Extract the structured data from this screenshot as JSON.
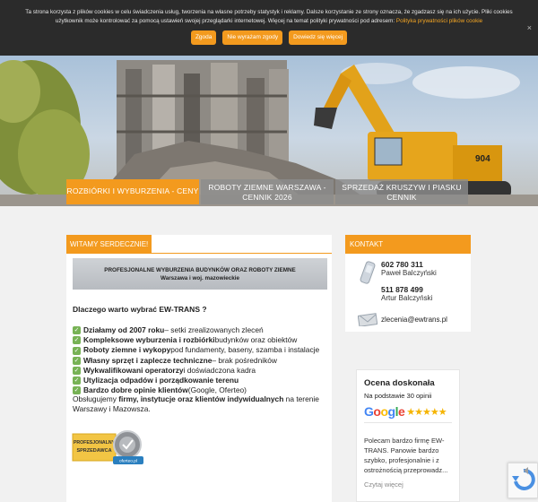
{
  "cookie": {
    "text": "Ta strona korzysta z plików cookies w celu świadczenia usług, tworzenia na własne potrzeby statystyk i reklamy. Dalsze korzystanie ze strony oznacza, że zgadzasz się na ich użycie. Pliki cookies użytkownik może kontrolować za pomocą ustawień swojej przeglądarki internetowej. Więcej na temat polityki prywatności pod adresem:",
    "link": "Polityka prywatności plików cookie",
    "btn_agree": "Zgoda",
    "btn_disagree": "Nie wyrażam zgody",
    "btn_more": "Dowiedz się więcej",
    "close": "×"
  },
  "nav": [
    {
      "label": "Rozbiórki i wyburzenia - ceny"
    },
    {
      "label": "ROBOTY ZIEMNE WARSZAWA - CENNIK 2026"
    },
    {
      "label": "SPRZEDAŻ KRUSZYW I PIASKU CENNIK"
    }
  ],
  "main": {
    "heading": "WITAMY SERDECZNIE!",
    "banner_title": "PROFESJONALNE WYBURZENIA BUDYNKÓW ORAZ ROBOTY ZIEMNE",
    "banner_sub": "Warszawa i woj. mazowieckie",
    "why": "Dlaczego warto wybrać EW-TRANS ?",
    "items": [
      {
        "bold": "Działamy od 2007 roku",
        "rest": " – setki zrealizowanych zleceń"
      },
      {
        "bold": "Kompleksowe wyburzenia i rozbiórki",
        "rest": " budynków oraz obiektów"
      },
      {
        "bold": "Roboty ziemne i wykopy",
        "rest": " pod fundamenty, baseny, szamba i instalacje"
      },
      {
        "bold": "Własny sprzęt i zaplecze techniczne",
        "rest": " – brak pośredników"
      },
      {
        "bold": "Wykwalifikowani operatorzy",
        "rest": " i doświadczona kadra"
      },
      {
        "bold": "Utylizacja odpadów i porządkowanie terenu",
        "rest": ""
      },
      {
        "bold": "Bardzo dobre opinie klientów",
        "rest": " (Google, Oferteo)"
      }
    ],
    "serve_a": "Obsługujemy ",
    "serve_b": "firmy, instytucje oraz klientów indywidualnych",
    "serve_c": " na terenie Warszawy i Mazowsza.",
    "badge_line1": "PROFESJONALNY",
    "badge_line2": "SPRZEDAWCA",
    "badge_brand": "oferteo.pl"
  },
  "contact": {
    "heading": "KONTAKT",
    "phone1": "602 780 311",
    "name1": "Paweł Balczyński",
    "phone2": "511 878 499",
    "name2": "Artur Balczyński",
    "email": "zlecenia@ewtrans.pl"
  },
  "review": {
    "title": "Ocena doskonała",
    "subtitle": "Na podstawie 30 opinii",
    "google": "Google",
    "stars": "★★★★★",
    "text": "Polecam bardzo firmę EW-TRANS. Panowie bardzo szybko, profesjonalnie i z ostrożnością przeprowadz...",
    "more": "Czytaj więcej"
  }
}
